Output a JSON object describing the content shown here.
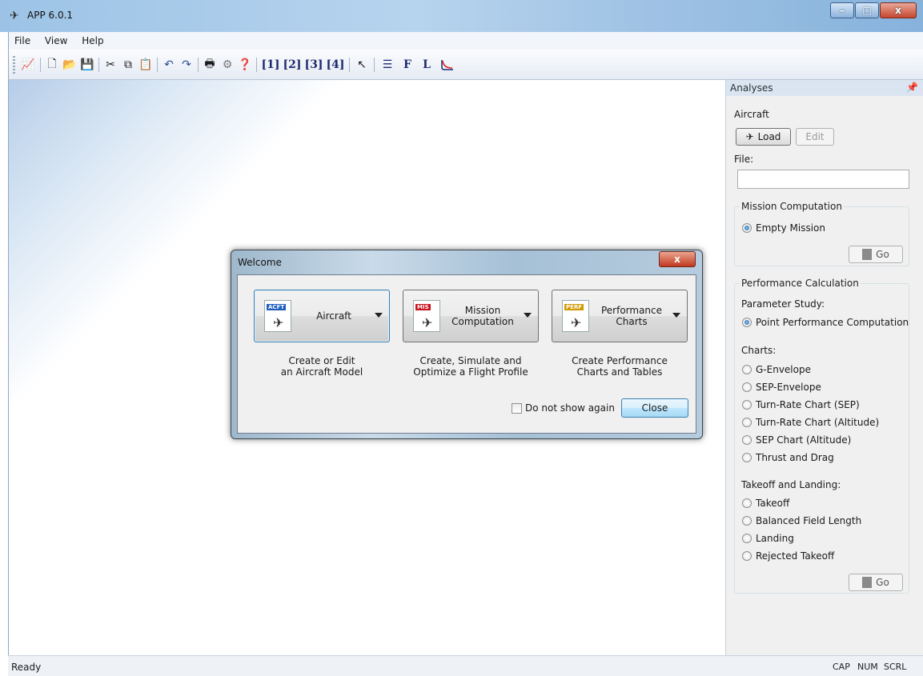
{
  "window": {
    "title": "APP 6.0.1",
    "minimize": "–",
    "maximize": "□",
    "close": "x"
  },
  "menu": [
    "File",
    "View",
    "Help"
  ],
  "toolbar": {
    "items": [
      "[1]",
      "[2]",
      "[3]",
      "[4]",
      "F",
      "L"
    ]
  },
  "panel": {
    "header": "Analyses",
    "pin": "ᵖ",
    "aircraft_label": "Aircraft",
    "load_label": "Load",
    "edit_label": "Edit",
    "file_label": "File:",
    "file_value": "",
    "mission_group": "Mission Computation",
    "mission_option": "Empty Mission",
    "go_label": "Go",
    "perf_group": "Performance Calculation",
    "param_label": "Parameter Study:",
    "param_option": "Point Performance Computation",
    "charts_label": "Charts:",
    "charts": [
      "G-Envelope",
      "SEP-Envelope",
      "Turn-Rate Chart (SEP)",
      "Turn-Rate Chart (Altitude)",
      "SEP Chart (Altitude)",
      "Thrust and Drag"
    ],
    "takeoff_label": "Takeoff and Landing:",
    "takeoff": [
      "Takeoff",
      "Balanced Field Length",
      "Landing",
      "Rejected Takeoff"
    ],
    "go2_label": "Go"
  },
  "dialog": {
    "title": "Welcome",
    "close_glyph": "x",
    "buttons": [
      {
        "tag": "ACFT",
        "label": "Aircraft",
        "desc_1": "Create or Edit",
        "desc_2": "an Aircraft Model"
      },
      {
        "tag": "MIS",
        "label_1": "Mission",
        "label_2": "Computation",
        "desc_1": "Create, Simulate and",
        "desc_2": "Optimize a Flight Profile"
      },
      {
        "tag": "PERF",
        "label_1": "Performance",
        "label_2": "Charts",
        "desc_1": "Create Performance",
        "desc_2": "Charts and Tables"
      }
    ],
    "checkbox_label": "Do not show again",
    "close_label": "Close"
  },
  "status": {
    "text": "Ready",
    "cap": "CAP",
    "num": "NUM",
    "scrl": "SCRL"
  },
  "colors": {
    "acft_tag": "#1f5fbf",
    "mis_tag": "#c8141e",
    "perf_tag": "#d19a00",
    "accent": "#3c7fb1"
  }
}
